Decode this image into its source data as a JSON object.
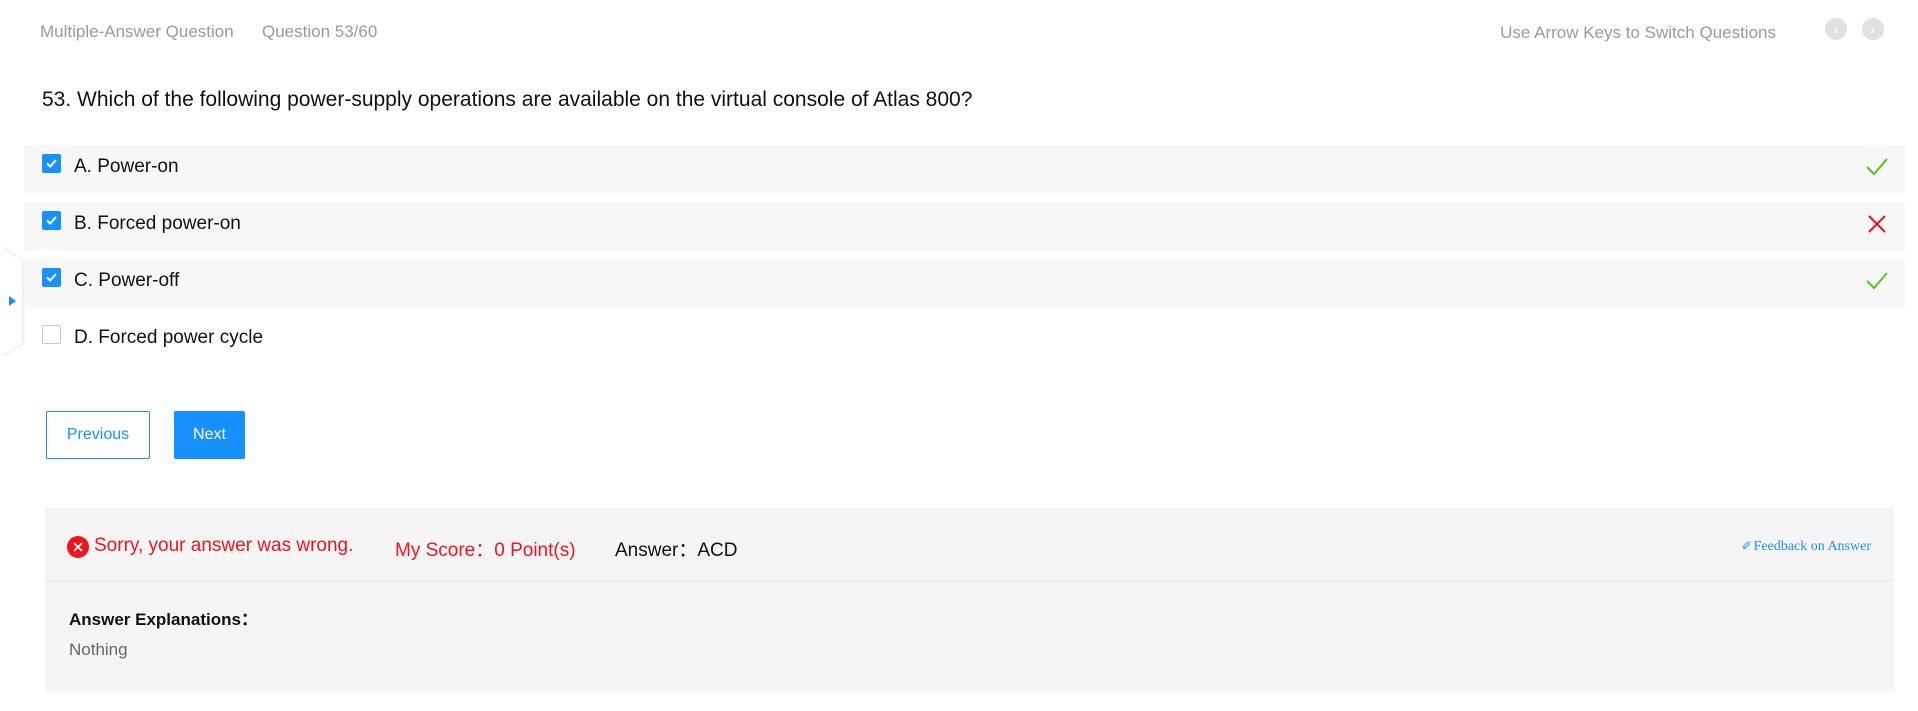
{
  "header": {
    "question_type": "Multiple-Answer Question",
    "question_counter": "Question 53/60",
    "nav_hint": "Use Arrow Keys to Switch Questions",
    "prev_icon": "chevron-left-icon",
    "next_icon": "chevron-right-icon"
  },
  "question": {
    "text": "53. Which of the following power-supply operations are available on the virtual console of Atlas 800?"
  },
  "options": [
    {
      "label": "A. Power-on",
      "checked": true,
      "result": "correct"
    },
    {
      "label": "B. Forced power-on",
      "checked": true,
      "result": "incorrect"
    },
    {
      "label": "C. Power-off",
      "checked": true,
      "result": "correct"
    },
    {
      "label": "D. Forced power cycle",
      "checked": false,
      "result": "none"
    }
  ],
  "buttons": {
    "previous": "Previous",
    "next": "Next"
  },
  "result": {
    "status_text": "Sorry, your answer was wrong.",
    "score_text": "My Score：0 Point(s)",
    "answer_text": "Answer：ACD",
    "feedback_link": "Feedback on Answer",
    "explanation_title": "Answer Explanations：",
    "explanation_body": "Nothing"
  },
  "colors": {
    "accent": "#1890ff",
    "error": "#f0141e",
    "correct": "#52c41a",
    "muted": "#9a9a9a"
  }
}
